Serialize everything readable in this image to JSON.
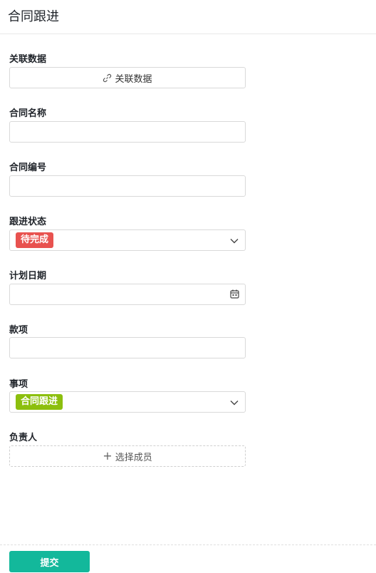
{
  "header": {
    "title": "合同跟进"
  },
  "fields": {
    "related_data": {
      "label": "关联数据",
      "button_label": "关联数据",
      "icon": "link-icon"
    },
    "contract_name": {
      "label": "合同名称",
      "value": ""
    },
    "contract_number": {
      "label": "合同编号",
      "value": ""
    },
    "follow_status": {
      "label": "跟进状态",
      "selected": "待完成",
      "tag_color": "#e8524f"
    },
    "planned_date": {
      "label": "计划日期",
      "value": "",
      "icon": "calendar-icon"
    },
    "payment": {
      "label": "款项",
      "value": ""
    },
    "matter": {
      "label": "事项",
      "selected": "合同跟进",
      "tag_color": "#8cbf0e"
    },
    "owner": {
      "label": "负责人",
      "button_label": "选择成员",
      "icon": "plus-icon"
    }
  },
  "footer": {
    "submit_label": "提交",
    "submit_color": "#13b89b"
  }
}
